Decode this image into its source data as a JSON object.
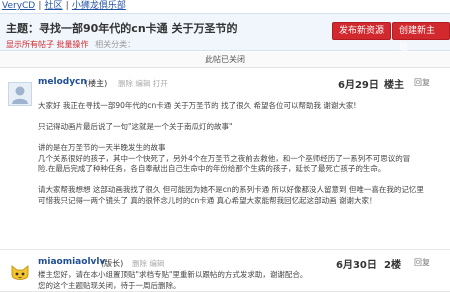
{
  "breadcrumb": {
    "site": "VeryCD",
    "section": "社区",
    "group": "小狮龙俱乐部"
  },
  "topic": {
    "title": "主题：寻找一部90年代的cn卡通 关于万圣节的",
    "show_all": "显示所有帖子",
    "batch": "批量操作",
    "count": "相关分类："
  },
  "buttons": {
    "new_resource": "发布新资源",
    "new_topic": "创建新主题"
  },
  "closed_notice": "此帖已关闭",
  "posts": [
    {
      "user": "melodycn",
      "role": "(楼主)",
      "actions": "删除 编辑 打开",
      "date": "6月29日",
      "floor": "楼主",
      "reply": "回复",
      "lines": [
        "大家好 我正在寻找一部90年代的cn卡通 关于万圣节的 找了很久 希望各位可以帮助我 谢谢大家!",
        "",
        "只记得动画片最后说了一句\"这就是一个关于南瓜灯的故事\"",
        "",
        "讲的是在万圣节的一天半晚发生的故事",
        "几个关系很好的孩子，其中一个快死了，另外4个在万圣节之夜前去救他，和一个巫师经历了一系列不可思议的冒",
        "险.在最后完成了种种任务，各自奉献出自己生命中的年份给那个生病的孩子，延长了最死亡孩子的生命。",
        "",
        "请大家帮我想想 这部动画我找了很久 但可能因为她不是cn的系列卡通 所以好像都没人留意到 但唯一喜在我的记忆里",
        "可惜我只记得一两个镜头了 真的很怀念儿时的cn卡通 真心希望大家能帮我回忆起这部动画 谢谢大家！"
      ]
    },
    {
      "user": "miaomiaolvlv",
      "role": "(版长)",
      "actions": "删除 编辑",
      "date": "6月30日",
      "floor": "2楼",
      "reply": "回复",
      "lines": [
        "楼主您好，请在本小组置顶贴\"求档专贴\"里重新以跟帖的方式发求助，谢谢配合。",
        "您的这个主题贴现关闭，待于一周后删除。"
      ]
    }
  ],
  "icons": {
    "avatar1": "user-avatar",
    "avatar2": "cat-avatar"
  },
  "colors": {
    "accent": "#d2292e",
    "link": "#1f4e96",
    "header_bg": "#f1f6fc"
  }
}
